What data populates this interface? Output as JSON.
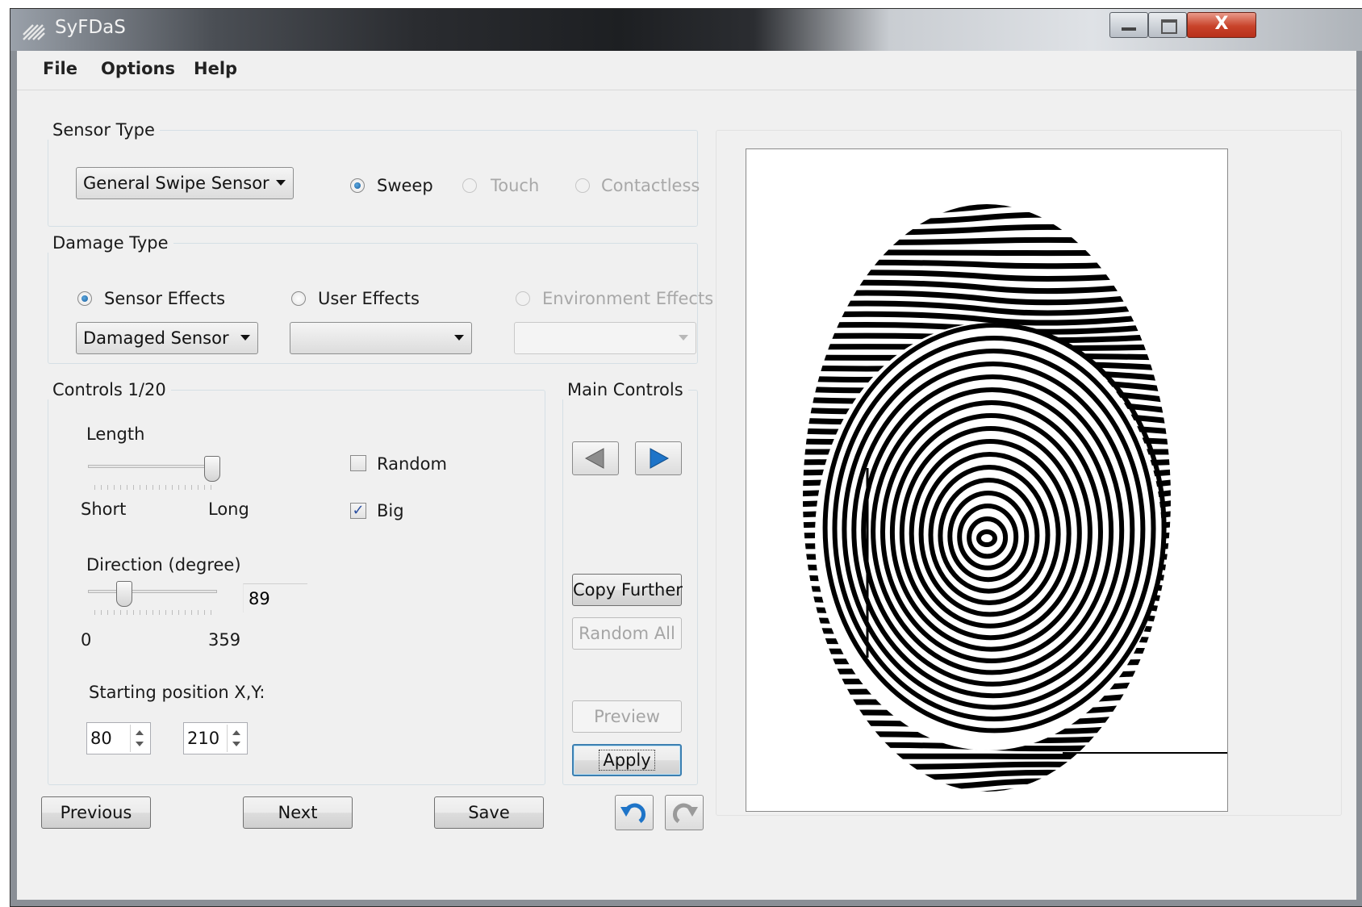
{
  "window": {
    "title": "SyFDaS",
    "close_glyph": "X"
  },
  "menu": {
    "file": "File",
    "options": "Options",
    "help": "Help"
  },
  "sensor_type": {
    "title": "Sensor Type",
    "combo_value": "General Swipe Sensor",
    "radio_sweep": "Sweep",
    "radio_touch": "Touch",
    "radio_contactless": "Contactless",
    "selected": "Sweep"
  },
  "damage_type": {
    "title": "Damage Type",
    "radio_sensor": "Sensor Effects",
    "radio_user": "User Effects",
    "radio_environment": "Environment Effects",
    "selected": "Sensor Effects",
    "sensor_combo_value": "Damaged Sensor",
    "user_combo_value": "",
    "environment_combo_value": ""
  },
  "controls": {
    "title": "Controls 1/20",
    "length": {
      "label": "Length",
      "min_label": "Short",
      "max_label": "Long",
      "position": 1.0
    },
    "random_label": "Random",
    "random_checked": false,
    "big_label": "Big",
    "big_checked": true,
    "direction": {
      "label": "Direction (degree)",
      "min_label": "0",
      "max_label": "359",
      "value": "89"
    },
    "start_label": "Starting position X,Y:",
    "start_x": "80",
    "start_y": "210"
  },
  "main_controls": {
    "title": "Main Controls",
    "copy_further": "Copy Further",
    "random_all": "Random All",
    "preview": "Preview",
    "apply": "Apply"
  },
  "bottom": {
    "previous": "Previous",
    "next": "Next",
    "save": "Save"
  },
  "colors": {
    "accent_blue": "#1e74c8",
    "window_bg": "#f0f0f0",
    "close_red": "#c8432a"
  }
}
